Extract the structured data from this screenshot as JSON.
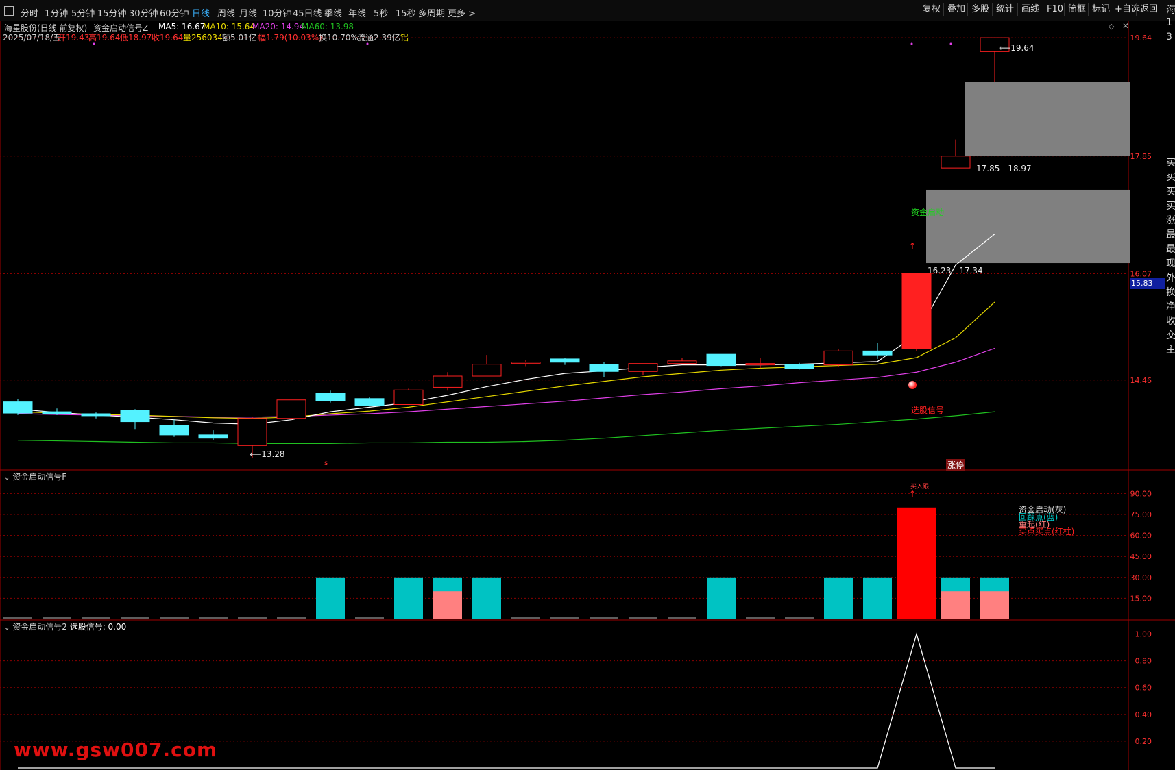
{
  "toolbar": {
    "timeframes": [
      "分时",
      "1分钟",
      "5分钟",
      "15分钟",
      "30分钟",
      "60分钟",
      "日线",
      "周线",
      "月线",
      "10分钟",
      "45日线",
      "季线",
      "年线",
      "5秒",
      "15秒",
      "多周期",
      "更多 >"
    ],
    "active_timeframe": "日线",
    "right_buttons": [
      "复权",
      "叠加",
      "多股",
      "统计",
      "画线",
      "F10",
      "简框",
      "标记",
      "+自选",
      "返回"
    ]
  },
  "header": {
    "title": "海星股份(日线 前复权)",
    "indicator": "资金启动信号Z",
    "ma5": "MA5: 16.67",
    "ma10": "MA10: 15.64",
    "ma20": "MA20: 14.94",
    "ma60": "MA60: 13.98",
    "date": "2025/07/18/五",
    "open": "开19.43",
    "high": "高19.64",
    "low": "低18.97",
    "close": "收19.64",
    "volume": "量256034",
    "amount": "额5.01亿",
    "change": "幅1.79(10.03%)",
    "turnover": "换10.70%",
    "float": "流通2.39亿",
    "sector": "铝"
  },
  "main_chart": {
    "price_ticks": [
      "19.64",
      "17.85",
      "16.07",
      "14.46"
    ],
    "current_price": "15.83",
    "high_label": "19.64",
    "low_label": "13.28",
    "zone1_label": "17.85 - 18.97",
    "zone2_label": "16.23 - 17.34",
    "signal_text": "资金启动",
    "select_text": "选股信号",
    "limit_up_text": "涨停",
    "s_marker": "s"
  },
  "panel2": {
    "title": "资金启动信号F",
    "ticks": [
      "90.00",
      "75.00",
      "60.00",
      "45.00",
      "30.00",
      "15.00"
    ],
    "legend": [
      "资金启动(灰)",
      "回踩点(蓝)",
      "重起(红)",
      "买点买点(红柱)"
    ],
    "top_label": "买入跟"
  },
  "panel3": {
    "title": "资金启动信号2",
    "value": "选股信号: 0.00",
    "ticks": [
      "1.00",
      "0.80",
      "0.60",
      "0.40",
      "0.20"
    ]
  },
  "side_strip": [
    "海",
    "1",
    "3",
    "买",
    "买",
    "买",
    "买",
    "涨",
    "最",
    "最",
    "现",
    "外",
    "换",
    "净",
    "收",
    "交",
    "主"
  ],
  "watermark": "www.gsw007.com",
  "colors": {
    "up": "#ff2020",
    "down": "#54f2ff",
    "ma5": "#ffffff",
    "ma10": "#e6d800",
    "ma20": "#e040e8",
    "ma60": "#20c020",
    "zone": "#808080",
    "cyan_bar": "#00c3c3",
    "pink_bar": "#ff8080",
    "grid": "#8a0000"
  },
  "chart_data": [
    {
      "type": "candlestick",
      "title": "海星股份(日线 前复权)",
      "candles": [
        {
          "o": 14.13,
          "h": 14.17,
          "l": 13.93,
          "c": 13.96
        },
        {
          "o": 13.98,
          "h": 14.03,
          "l": 13.93,
          "c": 13.95
        },
        {
          "o": 13.95,
          "h": 13.97,
          "l": 13.88,
          "c": 13.92
        },
        {
          "o": 14.0,
          "h": 14.02,
          "l": 13.72,
          "c": 13.83
        },
        {
          "o": 13.77,
          "h": 13.86,
          "l": 13.6,
          "c": 13.63
        },
        {
          "o": 13.63,
          "h": 13.7,
          "l": 13.55,
          "c": 13.58
        },
        {
          "o": 13.47,
          "h": 13.9,
          "l": 13.28,
          "c": 13.88
        },
        {
          "o": 13.88,
          "h": 14.16,
          "l": 13.86,
          "c": 14.16
        },
        {
          "o": 14.26,
          "h": 14.3,
          "l": 14.12,
          "c": 14.15
        },
        {
          "o": 14.18,
          "h": 14.2,
          "l": 14.06,
          "c": 14.07
        },
        {
          "o": 14.09,
          "h": 14.33,
          "l": 14.09,
          "c": 14.31
        },
        {
          "o": 14.35,
          "h": 14.58,
          "l": 14.3,
          "c": 14.52
        },
        {
          "o": 14.52,
          "h": 14.84,
          "l": 14.52,
          "c": 14.7
        },
        {
          "o": 14.71,
          "h": 14.76,
          "l": 14.67,
          "c": 14.73
        },
        {
          "o": 14.78,
          "h": 14.8,
          "l": 14.69,
          "c": 14.73
        },
        {
          "o": 14.7,
          "h": 14.73,
          "l": 14.51,
          "c": 14.59
        },
        {
          "o": 14.59,
          "h": 14.71,
          "l": 14.54,
          "c": 14.71
        },
        {
          "o": 14.71,
          "h": 14.79,
          "l": 14.71,
          "c": 14.75
        },
        {
          "o": 14.85,
          "h": 14.85,
          "l": 14.67,
          "c": 14.68
        },
        {
          "o": 14.69,
          "h": 14.79,
          "l": 14.64,
          "c": 14.71
        },
        {
          "o": 14.7,
          "h": 14.72,
          "l": 14.62,
          "c": 14.63
        },
        {
          "o": 14.69,
          "h": 14.93,
          "l": 14.66,
          "c": 14.9
        },
        {
          "o": 14.9,
          "h": 15.02,
          "l": 14.78,
          "c": 14.84
        },
        {
          "o": 16.07,
          "h": 16.07,
          "l": 14.9,
          "c": 14.94
        },
        {
          "o": 17.85,
          "h": 18.1,
          "l": 17.67,
          "c": 17.67
        },
        {
          "o": 19.43,
          "h": 19.64,
          "l": 18.97,
          "c": 19.64
        }
      ],
      "candle_colors": [
        "down",
        "down",
        "down",
        "down",
        "down",
        "down",
        "up",
        "up",
        "down",
        "down",
        "up",
        "up",
        "up",
        "up",
        "down",
        "down",
        "up",
        "up",
        "down",
        "up",
        "down",
        "up",
        "down",
        "up",
        "up",
        "up"
      ],
      "ma5": [
        14.02,
        13.97,
        13.93,
        13.9,
        13.86,
        13.81,
        13.79,
        13.86,
        13.98,
        14.05,
        14.12,
        14.23,
        14.36,
        14.47,
        14.56,
        14.6,
        14.65,
        14.69,
        14.69,
        14.69,
        14.7,
        14.72,
        14.74,
        15.15,
        16.2,
        16.67
      ],
      "ma10": [
        13.98,
        13.96,
        13.94,
        13.93,
        13.91,
        13.89,
        13.88,
        13.9,
        13.95,
        13.99,
        14.05,
        14.13,
        14.21,
        14.29,
        14.37,
        14.44,
        14.51,
        14.56,
        14.61,
        14.64,
        14.66,
        14.68,
        14.7,
        14.8,
        15.1,
        15.64
      ],
      "ma20": [
        13.95,
        13.94,
        13.93,
        13.92,
        13.91,
        13.9,
        13.9,
        13.91,
        13.93,
        13.95,
        13.98,
        14.02,
        14.06,
        14.1,
        14.14,
        14.19,
        14.24,
        14.28,
        14.33,
        14.37,
        14.42,
        14.46,
        14.5,
        14.58,
        14.73,
        14.94
      ],
      "ma60": [
        13.55,
        13.54,
        13.53,
        13.52,
        13.51,
        13.51,
        13.5,
        13.5,
        13.5,
        13.51,
        13.51,
        13.52,
        13.52,
        13.53,
        13.55,
        13.58,
        13.62,
        13.66,
        13.7,
        13.73,
        13.76,
        13.79,
        13.83,
        13.87,
        13.92,
        13.98
      ],
      "zones": [
        {
          "from": 17.85,
          "to": 18.97
        },
        {
          "from": 16.23,
          "to": 17.34
        }
      ],
      "ylim": [
        13.1,
        19.9
      ]
    },
    {
      "type": "bar",
      "title": "资金启动信号F",
      "cyan": [
        0,
        0,
        0,
        0,
        0,
        0,
        0,
        0,
        30,
        0,
        30,
        30,
        30,
        0,
        0,
        0,
        0,
        0,
        30,
        0,
        0,
        30,
        30,
        0,
        30,
        30
      ],
      "pink": [
        0,
        0,
        0,
        0,
        0,
        0,
        0,
        0,
        0,
        0,
        0,
        20,
        0,
        0,
        0,
        0,
        0,
        0,
        0,
        0,
        0,
        0,
        0,
        0,
        20,
        20
      ],
      "red": [
        0,
        0,
        0,
        0,
        0,
        0,
        0,
        0,
        0,
        0,
        0,
        0,
        0,
        0,
        0,
        0,
        0,
        0,
        0,
        0,
        0,
        0,
        0,
        80,
        0,
        0
      ],
      "ylim": [
        0,
        100
      ]
    },
    {
      "type": "line",
      "title": "资金启动信号2",
      "values": [
        0,
        0,
        0,
        0,
        0,
        0,
        0,
        0,
        0,
        0,
        0,
        0,
        0,
        0,
        0,
        0,
        0,
        0,
        0,
        0,
        0,
        0,
        0,
        1,
        0,
        0
      ],
      "ylim": [
        0,
        1.1
      ]
    }
  ]
}
